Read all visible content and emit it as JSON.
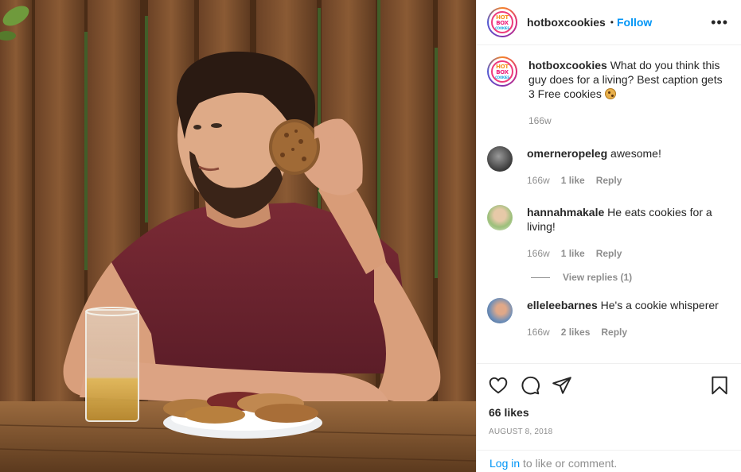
{
  "post": {
    "username": "hotboxcookies",
    "follow_label": "Follow",
    "separator": "•",
    "more_label": "•••",
    "logo_text": [
      "HOT",
      "BOX",
      "COOKIES"
    ]
  },
  "caption": {
    "username": "hotboxcookies",
    "text": "What do you think this guy does for a living? Best caption gets 3 Free cookies",
    "emoji": "cookie-emoji",
    "time": "166w"
  },
  "comments": [
    {
      "username": "omerneropeleg",
      "text": "awesome!",
      "time": "166w",
      "likes": "1 like",
      "reply": "Reply"
    },
    {
      "username": "hannahmakale",
      "text": "He eats cookies for a living!",
      "time": "166w",
      "likes": "1 like",
      "reply": "Reply",
      "view_replies": "View replies (1)"
    },
    {
      "username": "elleleebarnes",
      "text": "He's a cookie whisperer",
      "time": "166w",
      "likes": "2 likes",
      "reply": "Reply"
    }
  ],
  "actions": {
    "icons": [
      "heart-icon",
      "comment-icon",
      "share-icon",
      "bookmark-icon"
    ],
    "likes": "66 likes",
    "date": "AUGUST 8, 2018"
  },
  "login": {
    "link": "Log in",
    "rest": " to like or comment."
  },
  "colors": {
    "link_blue": "#0095f6",
    "muted_gray": "#8e8e8e",
    "text": "#262626"
  }
}
